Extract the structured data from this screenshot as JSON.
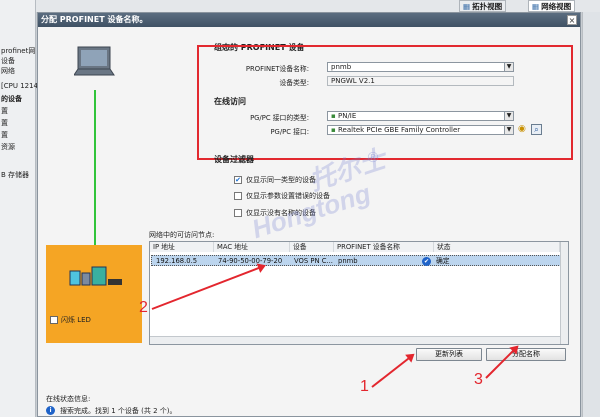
{
  "background": {
    "left_items": [
      "profinet网",
      "设备",
      "网络",
      "[CPU 1214",
      "的设备",
      "置",
      "置",
      "置",
      "资源",
      "B 存储器"
    ],
    "tabs": [
      {
        "label": "拓扑视图"
      },
      {
        "label": "网络视图"
      }
    ]
  },
  "dialog": {
    "title": "分配 PROFINET 设备名称。",
    "close": "×",
    "configured": {
      "heading": "组态的 PROFINET 设备",
      "name_label": "PROFINET设备名称:",
      "name_value": "pnmb",
      "type_label": "设备类型:",
      "type_value": "PNGWL V2.1"
    },
    "online": {
      "heading": "在线访问",
      "iface_type_label": "PG/PC 接口的类型:",
      "iface_type_value": "PN/IE",
      "iface_label": "PG/PC 接口:",
      "iface_value": "Realtek PCIe GBE Family Controller"
    },
    "filter": {
      "heading": "设备过滤器",
      "options": [
        {
          "label": "仅显示同一类型的设备",
          "checked": true
        },
        {
          "label": "仅显示参数设置错误的设备",
          "checked": false
        },
        {
          "label": "仅显示没有名称的设备",
          "checked": false
        }
      ]
    },
    "flash_led_label": "闪烁 LED",
    "table": {
      "title": "网络中的可访问节点:",
      "headers": [
        "IP 地址",
        "MAC 地址",
        "设备",
        "PROFINET 设备名称",
        "状态"
      ],
      "rows": [
        {
          "ip": "192.168.0.5",
          "mac": "74-90-50-00-79-20",
          "device": "VOS PN C...",
          "name": "pnmb",
          "status": "确定"
        }
      ]
    },
    "buttons": {
      "refresh": "更新列表",
      "assign": "分配名称"
    },
    "status_label": "在线状态信息:",
    "status_message": "搜索完成。找到 1 个设备 (共 2 个)。"
  },
  "annotations": {
    "one": "1",
    "two": "2",
    "three": "3"
  },
  "watermark": {
    "line1": "托尔士",
    "line2": "Hongtong",
    "mark": "®"
  },
  "colors": {
    "highlight_red": "#e2292f",
    "device_orange": "#f5a524",
    "link_green": "#31c43a",
    "selection_blue": "#bcd5ee"
  }
}
